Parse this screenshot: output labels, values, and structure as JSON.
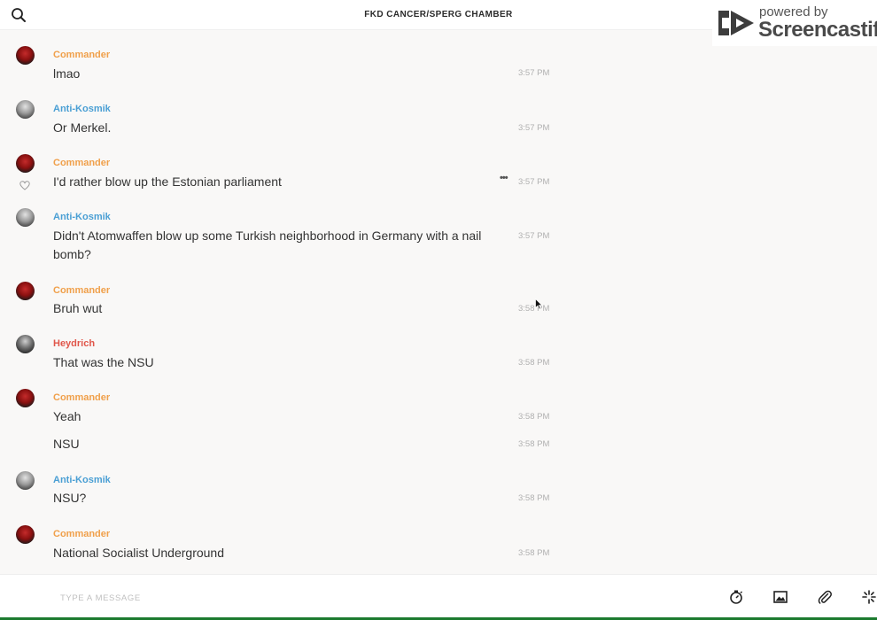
{
  "header": {
    "title": "FKD CANCER/SPERG CHAMBER",
    "search_icon": "search-icon",
    "call_icon": "phone-icon",
    "info_icon": "info-icon"
  },
  "watermark": {
    "powered": "powered by",
    "brand": "Screencastify"
  },
  "messages": [
    {
      "sender": "Commander",
      "text": "lmao",
      "time": "3:57 PM"
    },
    {
      "sender": "Anti-Kosmik",
      "text": "Or Merkel.",
      "time": "3:57 PM"
    },
    {
      "sender": "Commander",
      "text": "I'd rather blow up the Estonian parliament",
      "time": "3:57 PM",
      "more": "•••"
    },
    {
      "sender": "Anti-Kosmik",
      "text": "Didn't Atomwaffen blow up some Turkish neighborhood in Germany with a nail bomb?",
      "time": "3:57 PM"
    },
    {
      "sender": "Commander",
      "text": "Bruh wut",
      "time": "3:58 PM"
    },
    {
      "sender": "Heydrich",
      "text": "That was the NSU",
      "time": "3:58 PM"
    },
    {
      "sender": "Commander",
      "text": "Yeah",
      "time": "3:58 PM"
    },
    {
      "sender": "",
      "text": "NSU",
      "time": "3:58 PM"
    },
    {
      "sender": "Anti-Kosmik",
      "text": "NSU?",
      "time": "3:58 PM"
    },
    {
      "sender": "Commander",
      "text": "National Socialist Underground",
      "time": "3:58 PM"
    }
  ],
  "composer": {
    "placeholder": "TYPE A MESSAGE",
    "tools": [
      "timer-icon",
      "image-icon",
      "attachment-icon",
      "sparkle-icon"
    ]
  },
  "colors": {
    "commander": "#f0a04b",
    "anti_kosmik": "#4a9fd4",
    "heydrich": "#e0564a",
    "background": "#f9f8f7",
    "accent_line": "#1b7a2e"
  }
}
